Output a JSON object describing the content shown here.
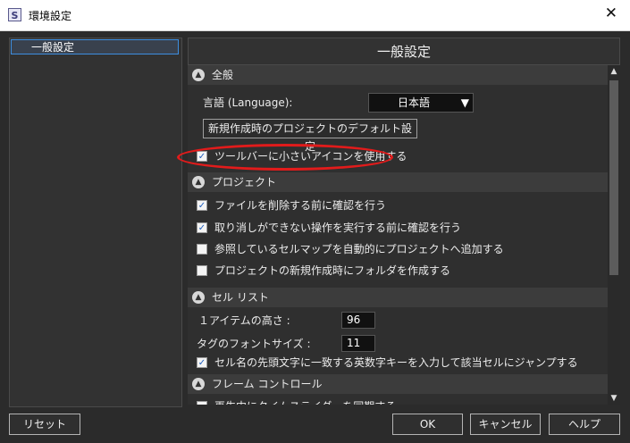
{
  "window": {
    "title": "環境設定",
    "app_icon": "S"
  },
  "sidebar": {
    "items": [
      {
        "label": "一般設定",
        "selected": true
      }
    ]
  },
  "panel": {
    "title": "一般設定"
  },
  "sections": {
    "general": {
      "label": "全般",
      "language_label": "言語 (Language):",
      "language_value": "日本語",
      "default_settings_button": "新規作成時のプロジェクトのデフォルト設定",
      "small_icons": {
        "label": "ツールバーに小さいアイコンを使用する",
        "checked": true
      }
    },
    "project": {
      "label": "プロジェクト",
      "options": [
        {
          "label": "ファイルを削除する前に確認を行う",
          "checked": true
        },
        {
          "label": "取り消しができない操作を実行する前に確認を行う",
          "checked": true
        },
        {
          "label": "参照しているセルマップを自動的にプロジェクトへ追加する",
          "checked": false
        },
        {
          "label": "プロジェクトの新規作成時にフォルダを作成する",
          "checked": false
        }
      ]
    },
    "cell_list": {
      "label": "セル リスト",
      "item_height_label": "１アイテムの高さ :",
      "item_height_value": "96",
      "tag_font_label": "タグのフォントサイズ :",
      "tag_font_value": "11",
      "jump_option": {
        "label": "セル名の先頭文字に一致する英数字キーを入力して該当セルにジャンプする",
        "checked": true
      }
    },
    "frame_control": {
      "label": "フレーム コントロール",
      "partial_option": {
        "label": "再生中にタイムスライダーを同期する",
        "checked": false
      }
    }
  },
  "footer": {
    "reset": "リセット",
    "ok": "OK",
    "cancel": "キャンセル",
    "help": "ヘルプ"
  },
  "colors": {
    "highlight": "#e21b1b",
    "selection_border": "#3d8ee0",
    "check": "#1f5fbf"
  },
  "icons": {
    "collapse": "chevron-up-icon",
    "close": "close-icon",
    "dropdown": "triangle-down-icon"
  }
}
